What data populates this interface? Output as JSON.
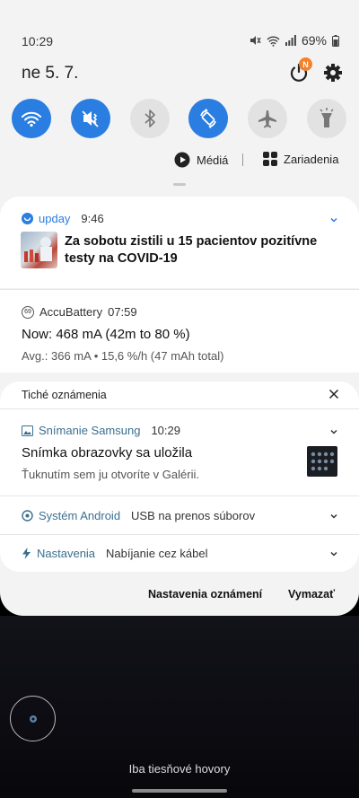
{
  "status_bar": {
    "time": "10:29",
    "battery": "69%"
  },
  "header": {
    "date": "ne 5. 7.",
    "notification_badge": "N"
  },
  "quick_settings": [
    {
      "name": "wifi",
      "on": true
    },
    {
      "name": "mute",
      "on": true
    },
    {
      "name": "bluetooth",
      "on": false
    },
    {
      "name": "auto-rotate",
      "on": true
    },
    {
      "name": "airplane",
      "on": false
    },
    {
      "name": "flashlight",
      "on": false
    }
  ],
  "media_row": {
    "media_label": "Médiá",
    "separator": "|",
    "devices_label": "Zariadenia"
  },
  "notifications": {
    "upday": {
      "app": "upday",
      "time": "9:46",
      "title": "Za sobotu zistili u 15 pacientov pozitívne testy na COVID-19"
    },
    "accubattery": {
      "app": "AccuBattery",
      "time": "07:59",
      "icon_value": "69",
      "line1": "Now: 468 mA (42m to 80 %)",
      "line2": "Avg.: 366 mA • 15,6 %/h (47 mAh total)"
    },
    "silent_header": "Tiché oznámenia",
    "samsung_capture": {
      "app": "Snímanie Samsung",
      "time": "10:29",
      "title": "Snímka obrazovky sa uložila",
      "body": "Ťuknutím sem ju otvoríte v Galérii."
    },
    "android_system": {
      "app": "Systém Android",
      "text": "USB na prenos súborov"
    },
    "settings": {
      "app": "Nastavenia",
      "text": "Nabíjanie cez kábel"
    }
  },
  "footer": {
    "settings_button": "Nastavenia oznámení",
    "clear_button": "Vymazať"
  },
  "lockscreen": {
    "emergency_text": "Iba tiesňové hovory"
  },
  "colors": {
    "accent_blue": "#2a7de1",
    "app_name": "#3a6f8f",
    "shade_bg": "#f3f3f3",
    "badge_orange": "#f4822b"
  }
}
